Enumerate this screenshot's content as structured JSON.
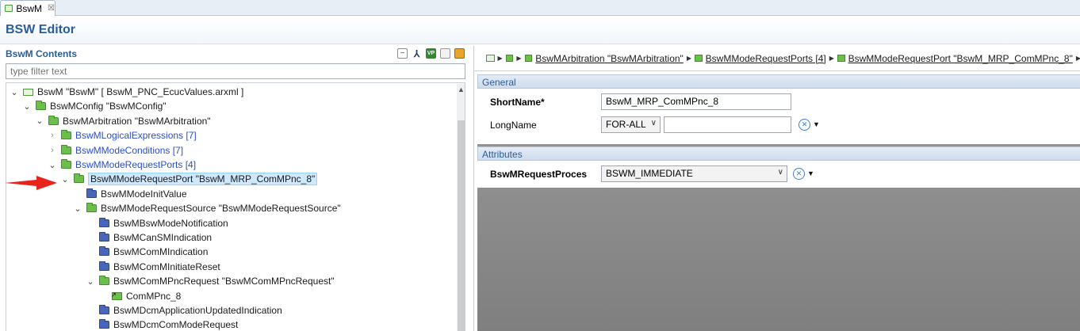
{
  "tab": {
    "label": "BswM",
    "close": "☒"
  },
  "editor": {
    "title": "BSW Editor"
  },
  "left": {
    "title": "BswM Contents",
    "filter_placeholder": "type filter text",
    "tree": [
      {
        "depth": 0,
        "twisty": "open",
        "icon": "root",
        "label": "BswM \"BswM\" [ BswM_PNC_EcucValues.arxml ]",
        "style": "normal"
      },
      {
        "depth": 1,
        "twisty": "open",
        "icon": "green",
        "label": "BswMConfig \"BswMConfig\"",
        "style": "normal"
      },
      {
        "depth": 2,
        "twisty": "open",
        "icon": "green",
        "label": "BswMArbitration \"BswMArbitration\"",
        "style": "normal"
      },
      {
        "depth": 3,
        "twisty": "closed",
        "icon": "green",
        "label": "BswMLogicalExpressions [7]",
        "style": "blue"
      },
      {
        "depth": 3,
        "twisty": "closed",
        "icon": "green",
        "label": "BswMModeConditions [7]",
        "style": "blue"
      },
      {
        "depth": 3,
        "twisty": "open",
        "icon": "green",
        "label": "BswMModeRequestPorts [4]",
        "style": "blue"
      },
      {
        "depth": 4,
        "twisty": "open",
        "icon": "green",
        "label": "BswMModeRequestPort \"BswM_MRP_ComMPnc_8\"",
        "style": "selected"
      },
      {
        "depth": 5,
        "twisty": "none",
        "icon": "blue",
        "label": "BswMModeInitValue",
        "style": "normal"
      },
      {
        "depth": 5,
        "twisty": "open",
        "icon": "green",
        "label": "BswMModeRequestSource \"BswMModeRequestSource\"",
        "style": "normal"
      },
      {
        "depth": 6,
        "twisty": "none",
        "icon": "blue",
        "label": "BswMBswModeNotification",
        "style": "normal"
      },
      {
        "depth": 6,
        "twisty": "none",
        "icon": "blue",
        "label": "BswMCanSMIndication",
        "style": "normal"
      },
      {
        "depth": 6,
        "twisty": "none",
        "icon": "blue",
        "label": "BswMComMIndication",
        "style": "normal"
      },
      {
        "depth": 6,
        "twisty": "none",
        "icon": "blue",
        "label": "BswMComMInitiateReset",
        "style": "normal"
      },
      {
        "depth": 6,
        "twisty": "open",
        "icon": "green",
        "label": "BswMComMPncRequest \"BswMComMPncRequest\"",
        "style": "normal"
      },
      {
        "depth": 7,
        "twisty": "none",
        "icon": "ref",
        "label": "ComMPnc_8",
        "style": "normal"
      },
      {
        "depth": 6,
        "twisty": "none",
        "icon": "blue",
        "label": "BswMDcmApplicationUpdatedIndication",
        "style": "normal"
      },
      {
        "depth": 6,
        "twisty": "none",
        "icon": "blue",
        "label": "BswMDcmComModeRequest",
        "style": "normal"
      }
    ]
  },
  "breadcrumb": [
    "BswMArbitration \"BswMArbitration\"",
    "BswMModeRequestPorts [4]",
    "BswMModeRequestPort \"BswM_MRP_ComMPnc_8\""
  ],
  "general": {
    "section_title": "General",
    "shortname_label": "ShortName*",
    "shortname_value": "BswM_MRP_ComMPnc_8",
    "longname_label": "LongName",
    "longname_lang": "FOR-ALL",
    "longname_value": ""
  },
  "attributes": {
    "section_title": "Attributes",
    "request_label": "BswMRequestProces",
    "request_value": "BSWM_IMMEDIATE"
  },
  "colors": {
    "accent": "#2b5d95",
    "selection": "#cde8ff",
    "annotation_arrow": "#e8231c"
  }
}
